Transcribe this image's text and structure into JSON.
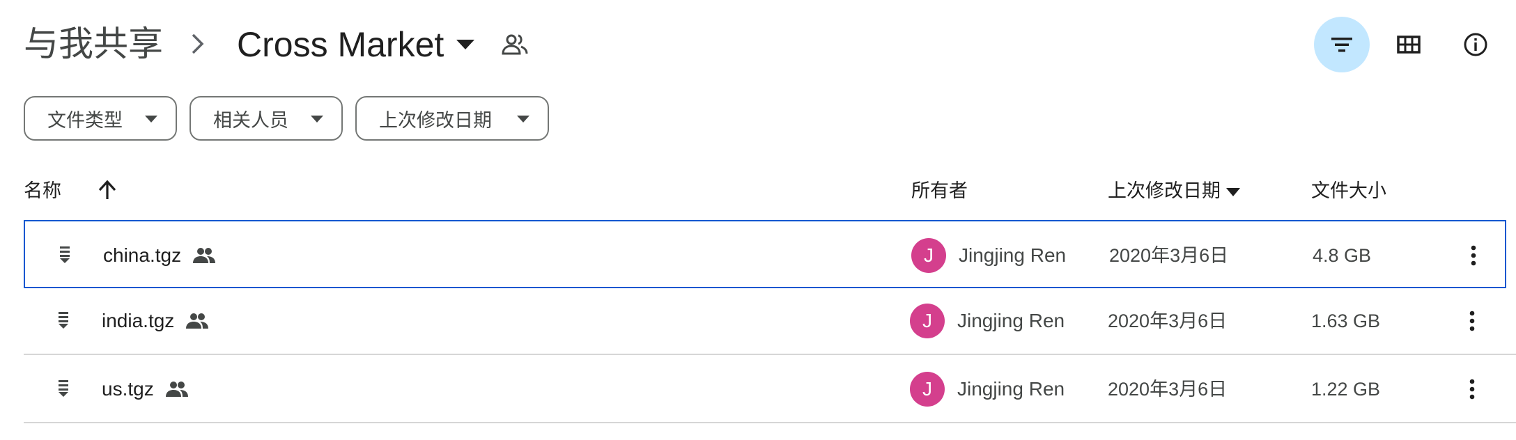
{
  "breadcrumb": {
    "root": "与我共享",
    "folder": "Cross Market"
  },
  "toolbar": {
    "filter_icon": "filter-icon",
    "grid_icon": "grid-view-icon",
    "info_icon": "info-icon"
  },
  "filters": [
    {
      "label": "文件类型"
    },
    {
      "label": "相关人员"
    },
    {
      "label": "上次修改日期"
    }
  ],
  "table": {
    "headers": {
      "name": "名称",
      "owner": "所有者",
      "modified": "上次修改日期",
      "size": "文件大小"
    },
    "rows": [
      {
        "name": "china.tgz",
        "owner_initial": "J",
        "owner": "Jingjing Ren",
        "modified": "2020年3月6日",
        "size": "4.8 GB",
        "selected": true
      },
      {
        "name": "india.tgz",
        "owner_initial": "J",
        "owner": "Jingjing Ren",
        "modified": "2020年3月6日",
        "size": "1.63 GB",
        "selected": false
      },
      {
        "name": "us.tgz",
        "owner_initial": "J",
        "owner": "Jingjing Ren",
        "modified": "2020年3月6日",
        "size": "1.22 GB",
        "selected": false
      }
    ]
  },
  "colors": {
    "accent_bg": "#c2e7ff",
    "selection_border": "#0b57d0",
    "avatar_bg": "#d43f8d"
  }
}
